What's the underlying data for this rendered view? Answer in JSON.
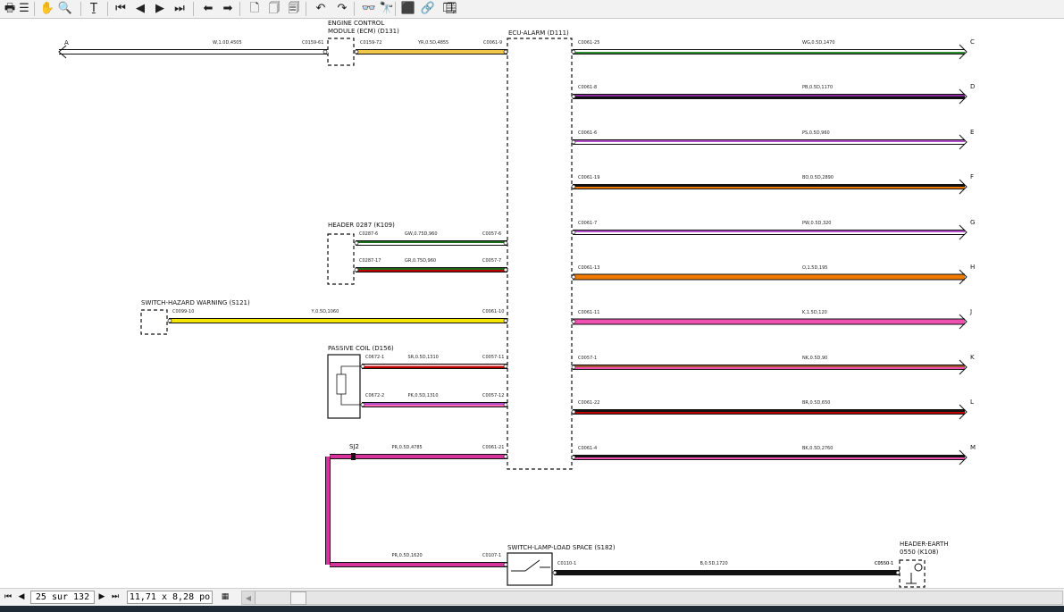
{
  "toolbar": {
    "items": [
      {
        "name": "print-icon",
        "glyph": "🖶"
      },
      {
        "name": "outline-icon",
        "glyph": "☰"
      },
      {
        "name": "hand-tool-icon",
        "glyph": "✋"
      },
      {
        "name": "zoom-icon",
        "glyph": "🔍"
      },
      {
        "name": "text-select-icon",
        "glyph": "Ṯ"
      },
      {
        "name": "first-page-icon",
        "glyph": "⏮"
      },
      {
        "name": "prev-page-icon",
        "glyph": "◀"
      },
      {
        "name": "next-page-icon",
        "glyph": "▶"
      },
      {
        "name": "last-page-icon",
        "glyph": "⏭"
      },
      {
        "name": "back-icon",
        "glyph": "⬅"
      },
      {
        "name": "forward-icon",
        "glyph": "➡"
      },
      {
        "name": "single-page-icon",
        "glyph": "🗋"
      },
      {
        "name": "continuous-icon",
        "glyph": "🗍"
      },
      {
        "name": "facing-icon",
        "glyph": "🗐"
      },
      {
        "name": "rotate-left-icon",
        "glyph": "↶"
      },
      {
        "name": "rotate-right-icon",
        "glyph": "↷"
      },
      {
        "name": "find-icon",
        "glyph": "👓"
      },
      {
        "name": "find-next-icon",
        "glyph": "🔭"
      },
      {
        "name": "bookmark-icon",
        "glyph": "⬛"
      },
      {
        "name": "link-icon",
        "glyph": "🔗"
      },
      {
        "name": "copy-page-icon",
        "glyph": "❐"
      },
      {
        "name": "export-icon",
        "glyph": "🗒"
      }
    ]
  },
  "diagram": {
    "modules": {
      "ecm": "ENGINE CONTROL",
      "ecm2": "MODULE (ECM) (D131)",
      "ecu": "ECU-ALARM (D111)",
      "header_0287": "HEADER 0287 (K109)",
      "switch_hazard": "SWITCH-HAZARD WARNING (S121)",
      "passive_coil": "PASSIVE COIL (D156)",
      "switch_lamp": "SWITCH-LAMP-LOAD SPACE (S182)",
      "header_earth": "HEADER-EARTH",
      "header_earth2": "0550 (K108)",
      "splice": "SJ2"
    },
    "left_wires": [
      {
        "id": "a",
        "end": "A",
        "pins": [
          "C0159-61",
          "C0159-72",
          "C0061-9"
        ],
        "spec": "W,1.0D,4505",
        "spec2": "YR,0.5D,4855",
        "colors": [
          "#ffffff",
          "#f2c64a"
        ]
      },
      {
        "id": "gw",
        "pins": [
          "C0287-6",
          "C0057-6"
        ],
        "spec": "GW,0.75D,960",
        "colors": [
          "#1a6b1a",
          "#ffffff"
        ]
      },
      {
        "id": "gr",
        "pins": [
          "C0287-17",
          "C0057-7"
        ],
        "spec": "GR,0.75D,960",
        "colors": [
          "#1a6b1a",
          "#c00000"
        ]
      },
      {
        "id": "y",
        "pins": [
          "C0099-10",
          "C0061-10"
        ],
        "spec": "Y,0.5D,1060",
        "colors": [
          "#f2e600",
          "#f2e600"
        ]
      },
      {
        "id": "sr",
        "pins": [
          "C0672-1",
          "C0057-11"
        ],
        "spec": "SR,0.5D,1310",
        "colors": [
          "#f0b8b8",
          "#c00000"
        ]
      },
      {
        "id": "pk",
        "pins": [
          "C0672-2",
          "C0057-12"
        ],
        "spec": "PK,0.5D,1310",
        "colors": [
          "#b44bc8",
          "#ff69b4"
        ]
      },
      {
        "id": "pr",
        "pins": [
          "C0061-21"
        ],
        "spec": "PR,0.5D,4785",
        "colors": [
          "#d6339a",
          "#d6339a"
        ]
      },
      {
        "id": "pr2",
        "pins": [
          "C0107-1"
        ],
        "spec": "PR,0.5D,1620",
        "colors": [
          "#d6339a",
          "#d6339a"
        ]
      },
      {
        "id": "b",
        "pins": [
          "C0110-1",
          "C0550-1"
        ],
        "spec": "B,0.5D,1720",
        "colors": [
          "#111111",
          "#111111"
        ]
      }
    ],
    "right_wires": [
      {
        "end": "C",
        "pin": "C0061-25",
        "spec": "WG,0.5D,1470",
        "colors": [
          "#ffffff",
          "#2e8b2e"
        ]
      },
      {
        "end": "D",
        "pin": "C0061-8",
        "spec": "PB,0.5D,1170",
        "colors": [
          "#8b2a9e",
          "#111111"
        ]
      },
      {
        "end": "E",
        "pin": "C0061-6",
        "spec": "PS,0.5D,960",
        "colors": [
          "#b44bc8",
          "#ffffff"
        ]
      },
      {
        "end": "F",
        "pin": "C0061-19",
        "spec": "BO,0.5D,2890",
        "colors": [
          "#111111",
          "#f07a00"
        ]
      },
      {
        "end": "G",
        "pin": "C0061-7",
        "spec": "PW,0.5D,320",
        "colors": [
          "#b44bc8",
          "#ffffff"
        ]
      },
      {
        "end": "H",
        "pin": "C0061-13",
        "spec": "O,1.5D,195",
        "colors": [
          "#f07a00",
          "#f07a00"
        ]
      },
      {
        "end": "J",
        "pin": "C0061-11",
        "spec": "K,1.5D,120",
        "colors": [
          "#f050b0",
          "#f050b0"
        ]
      },
      {
        "end": "K",
        "pin": "C0057-1",
        "spec": "NK,0.5D,90",
        "colors": [
          "#a0522d",
          "#f050b0"
        ]
      },
      {
        "end": "L",
        "pin": "C0061-22",
        "spec": "BR,0.5D,650",
        "colors": [
          "#111111",
          "#c00000"
        ]
      },
      {
        "end": "M",
        "pin": "C0061-4",
        "spec": "BK,0.5D,2760",
        "colors": [
          "#111111",
          "#f050b0"
        ]
      }
    ]
  },
  "statusbar": {
    "page_field": "25 sur 132",
    "size_field": "11,71 x 8,28 po",
    "first": "⏮",
    "prev": "◀",
    "next": "▶",
    "last": "⏭",
    "layout": "▦"
  }
}
